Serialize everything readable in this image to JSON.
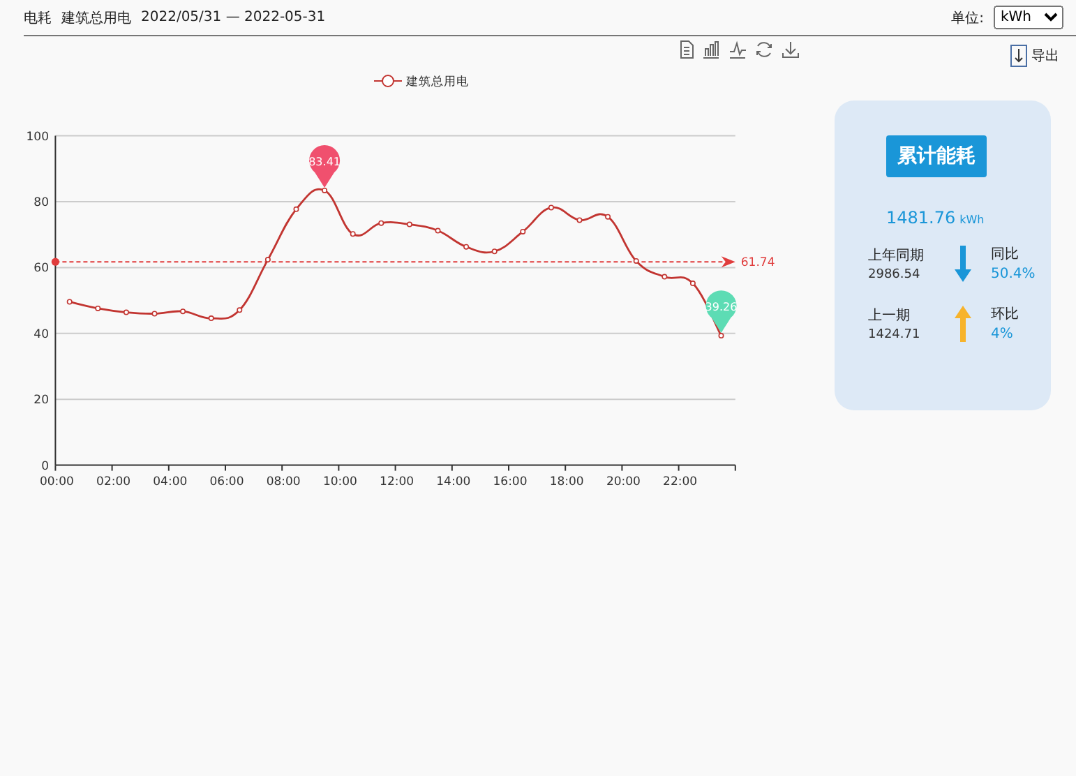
{
  "header": {
    "metric": "电耗",
    "scope": "建筑总用电",
    "date_range": "2022/05/31 — 2022-05-31",
    "unit_label": "单位:",
    "unit_value": "kWh"
  },
  "toolbar": {
    "export_label": "导出"
  },
  "chart": {
    "chart_data": {
      "type": "line",
      "x": [
        0.5,
        1.5,
        2.5,
        3.5,
        4.5,
        5.5,
        6.5,
        7.5,
        8.5,
        9.5,
        10.5,
        11.5,
        12.5,
        13.5,
        14.5,
        15.5,
        16.5,
        17.5,
        18.5,
        19.5,
        20.5,
        21.5,
        22.5,
        23.5
      ],
      "series": [
        {
          "name": "建筑总用电",
          "color": "#c23531",
          "marker": "circle",
          "values": [
            49.6,
            47.6,
            46.4,
            46.0,
            46.7,
            44.6,
            47.1,
            62.4,
            77.7,
            83.4,
            70.2,
            73.5,
            73.1,
            71.2,
            66.3,
            64.9,
            70.9,
            78.2,
            74.4,
            75.4,
            62.0,
            57.2,
            55.2,
            39.3
          ]
        }
      ],
      "grid": true,
      "xlim": [
        0,
        24
      ],
      "ylim": [
        0,
        100
      ],
      "xticks": [
        {
          "value": 0,
          "label": "00:00"
        },
        {
          "value": 2,
          "label": "02:00"
        },
        {
          "value": 4,
          "label": "04:00"
        },
        {
          "value": 6,
          "label": "06:00"
        },
        {
          "value": 8,
          "label": "08:00"
        },
        {
          "value": 10,
          "label": "10:00"
        },
        {
          "value": 12,
          "label": "12:00"
        },
        {
          "value": 14,
          "label": "14:00"
        },
        {
          "value": 16,
          "label": "16:00"
        },
        {
          "value": 18,
          "label": "18:00"
        },
        {
          "value": 20,
          "label": "20:00"
        },
        {
          "value": 22,
          "label": "22:00"
        }
      ],
      "yticks": [
        0,
        20,
        40,
        60,
        80,
        100
      ],
      "annotations": [
        {
          "text": "83.41",
          "x": 9.5,
          "y": 83.4
        },
        {
          "text": "39.26",
          "x": 23.5,
          "y": 39.3
        }
      ],
      "ref_lines": [
        {
          "axis": "y",
          "value": 61.74,
          "label": "61.74"
        }
      ]
    }
  },
  "summary": {
    "title": "累计能耗",
    "total": "1481.76",
    "unit": "kWh",
    "comparisons": [
      {
        "label": "上年同期",
        "value": "2986.54",
        "kind": "decrease",
        "color": "#1a96d8",
        "ratio_label": "同比",
        "ratio": "50.4%"
      },
      {
        "label": "上一期",
        "value": "1424.71",
        "kind": "increase",
        "color": "#f7b32b",
        "ratio_label": "环比",
        "ratio": "4%"
      }
    ]
  }
}
